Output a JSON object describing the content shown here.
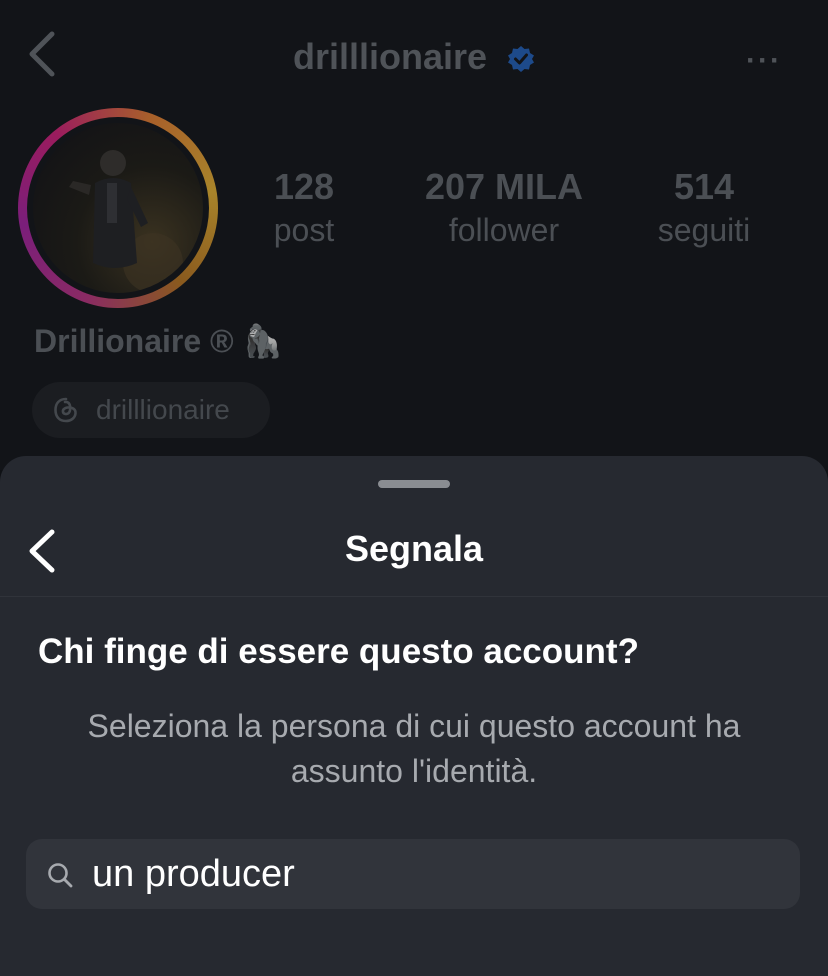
{
  "profile": {
    "username": "drilllionaire",
    "more_label": "···",
    "stats": [
      {
        "value": "128",
        "label": "post"
      },
      {
        "value": "207 MILA",
        "label": "follower"
      },
      {
        "value": "514",
        "label": "seguiti"
      }
    ],
    "display_name": "Drillionaire ® 🦍",
    "threads_handle": "drilllionaire"
  },
  "sheet": {
    "title": "Segnala",
    "question": "Chi finge di essere questo account?",
    "subtext": "Seleziona la persona di cui questo account ha assunto l'identità.",
    "search_value": "un producer"
  },
  "colors": {
    "verified": "#3b82f6",
    "sheet_bg": "#262930",
    "accent_text": "#ffffff"
  }
}
